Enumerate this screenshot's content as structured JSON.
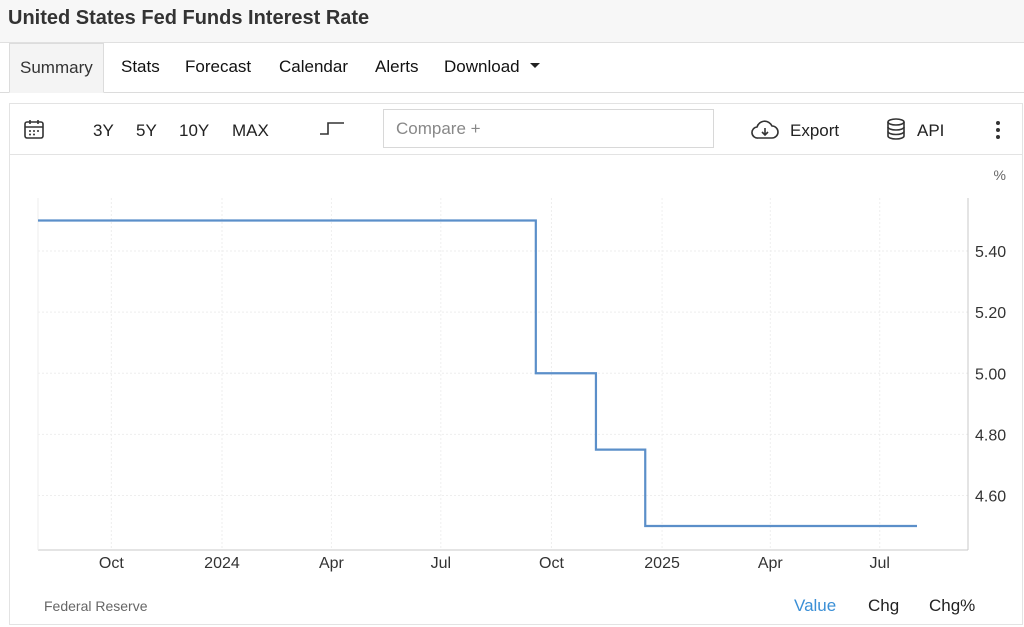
{
  "page_title": "United States Fed Funds Interest Rate",
  "nav": {
    "tabs": [
      "Summary",
      "Stats",
      "Forecast",
      "Calendar",
      "Alerts",
      "Download"
    ],
    "active": "Summary"
  },
  "toolbar": {
    "ranges": [
      "3Y",
      "5Y",
      "10Y",
      "MAX"
    ],
    "compare_placeholder": "Compare +",
    "export_label": "Export",
    "api_label": "API"
  },
  "chart_data": {
    "type": "line",
    "step": true,
    "unit": "%",
    "x_ticks": [
      "Oct",
      "2024",
      "Apr",
      "Jul",
      "Oct",
      "2025",
      "Apr",
      "Jul"
    ],
    "y_ticks": [
      "4.60",
      "4.80",
      "5.00",
      "5.20",
      "5.40"
    ],
    "ylim": [
      4.43,
      5.6
    ],
    "series": [
      {
        "points": [
          {
            "date": "2023-08-01",
            "value": 5.5
          },
          {
            "date": "2024-09-18",
            "value": 5.0
          },
          {
            "date": "2024-11-07",
            "value": 4.75
          },
          {
            "date": "2024-12-18",
            "value": 4.5
          },
          {
            "date": "2025-08-01",
            "value": 4.5
          }
        ]
      }
    ],
    "line_color": "#5b8fc9",
    "grid": true
  },
  "footer": {
    "source": "Federal Reserve",
    "tabs": [
      "Value",
      "Chg",
      "Chg%"
    ],
    "active": "Value"
  }
}
